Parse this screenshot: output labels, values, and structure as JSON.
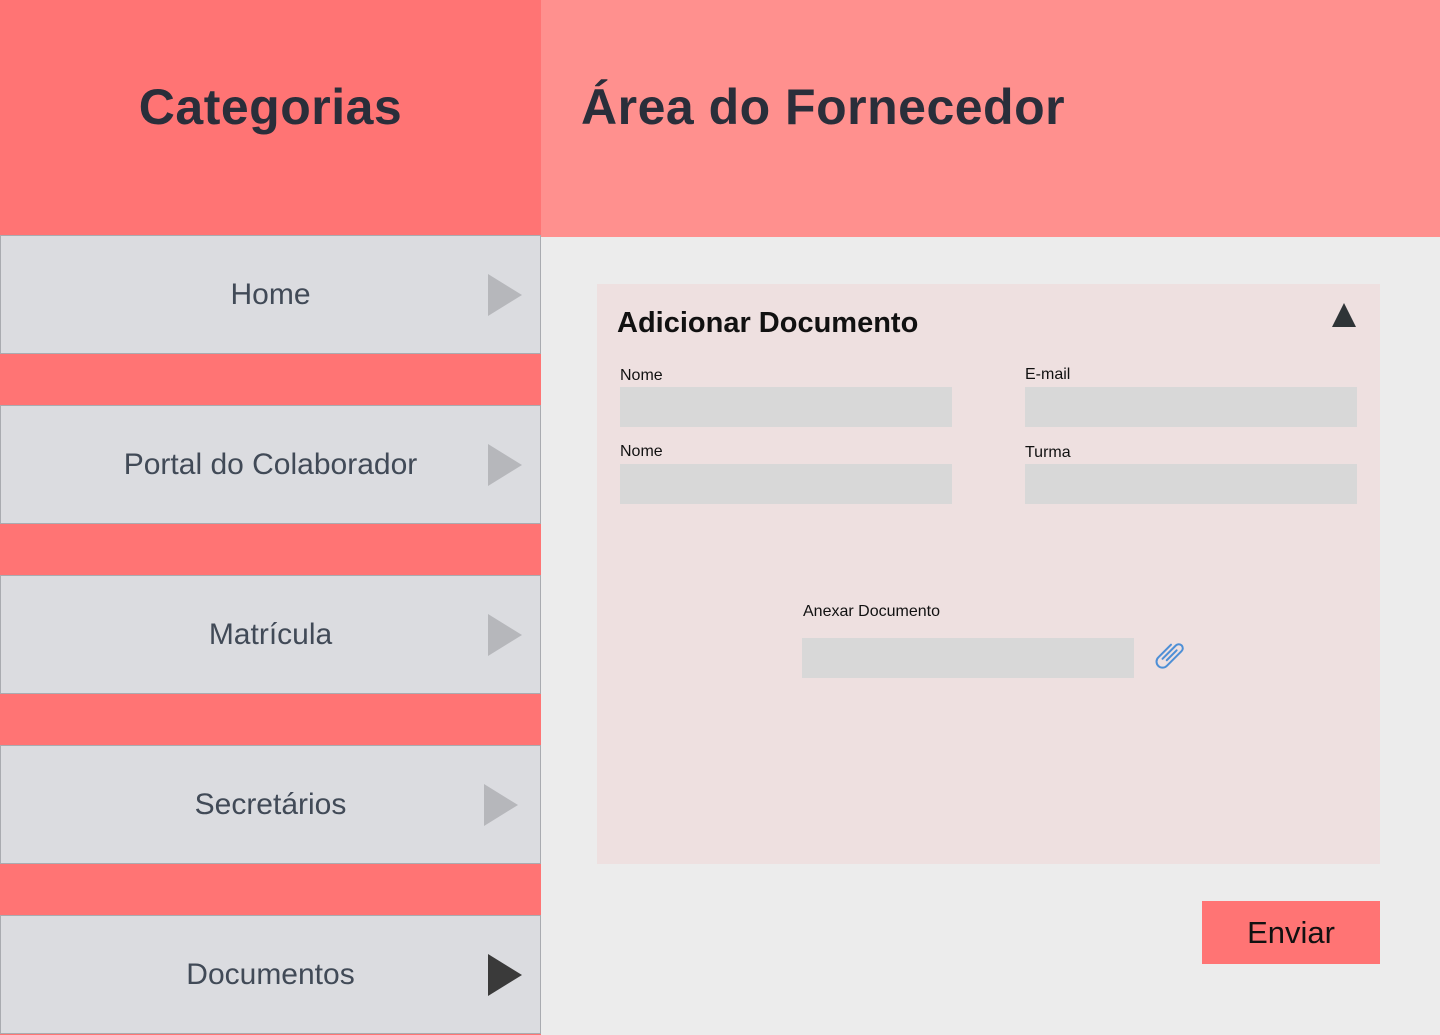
{
  "sidebar": {
    "title": "Categorias",
    "items": [
      {
        "label": "Home",
        "active": false
      },
      {
        "label": "Portal do Colaborador",
        "active": false
      },
      {
        "label": "Matrícula",
        "active": false
      },
      {
        "label": "Secretários",
        "active": false
      },
      {
        "label": "Documentos",
        "active": true
      }
    ]
  },
  "header": {
    "title": "Área do Fornecedor"
  },
  "form": {
    "title": "Adicionar Documento",
    "collapse_icon": "triangle-up-icon",
    "fields": [
      {
        "label": "Nome",
        "value": "",
        "placeholder": ""
      },
      {
        "label": "E-mail",
        "value": "",
        "placeholder": ""
      },
      {
        "label": "Nome",
        "value": "",
        "placeholder": ""
      },
      {
        "label": "Turma",
        "value": "",
        "placeholder": ""
      }
    ],
    "attachment": {
      "label": "Anexar Documento",
      "value": "",
      "icon": "paperclip-icon"
    },
    "submit_label": "Enviar"
  },
  "colors": {
    "sidebar_bg": "#ff7474",
    "header_bg": "#ff908e",
    "panel_bg": "#eee0e0",
    "content_bg": "#ececec",
    "nav_item_bg": "#dbdce0",
    "submit_bg": "#ff7474"
  }
}
